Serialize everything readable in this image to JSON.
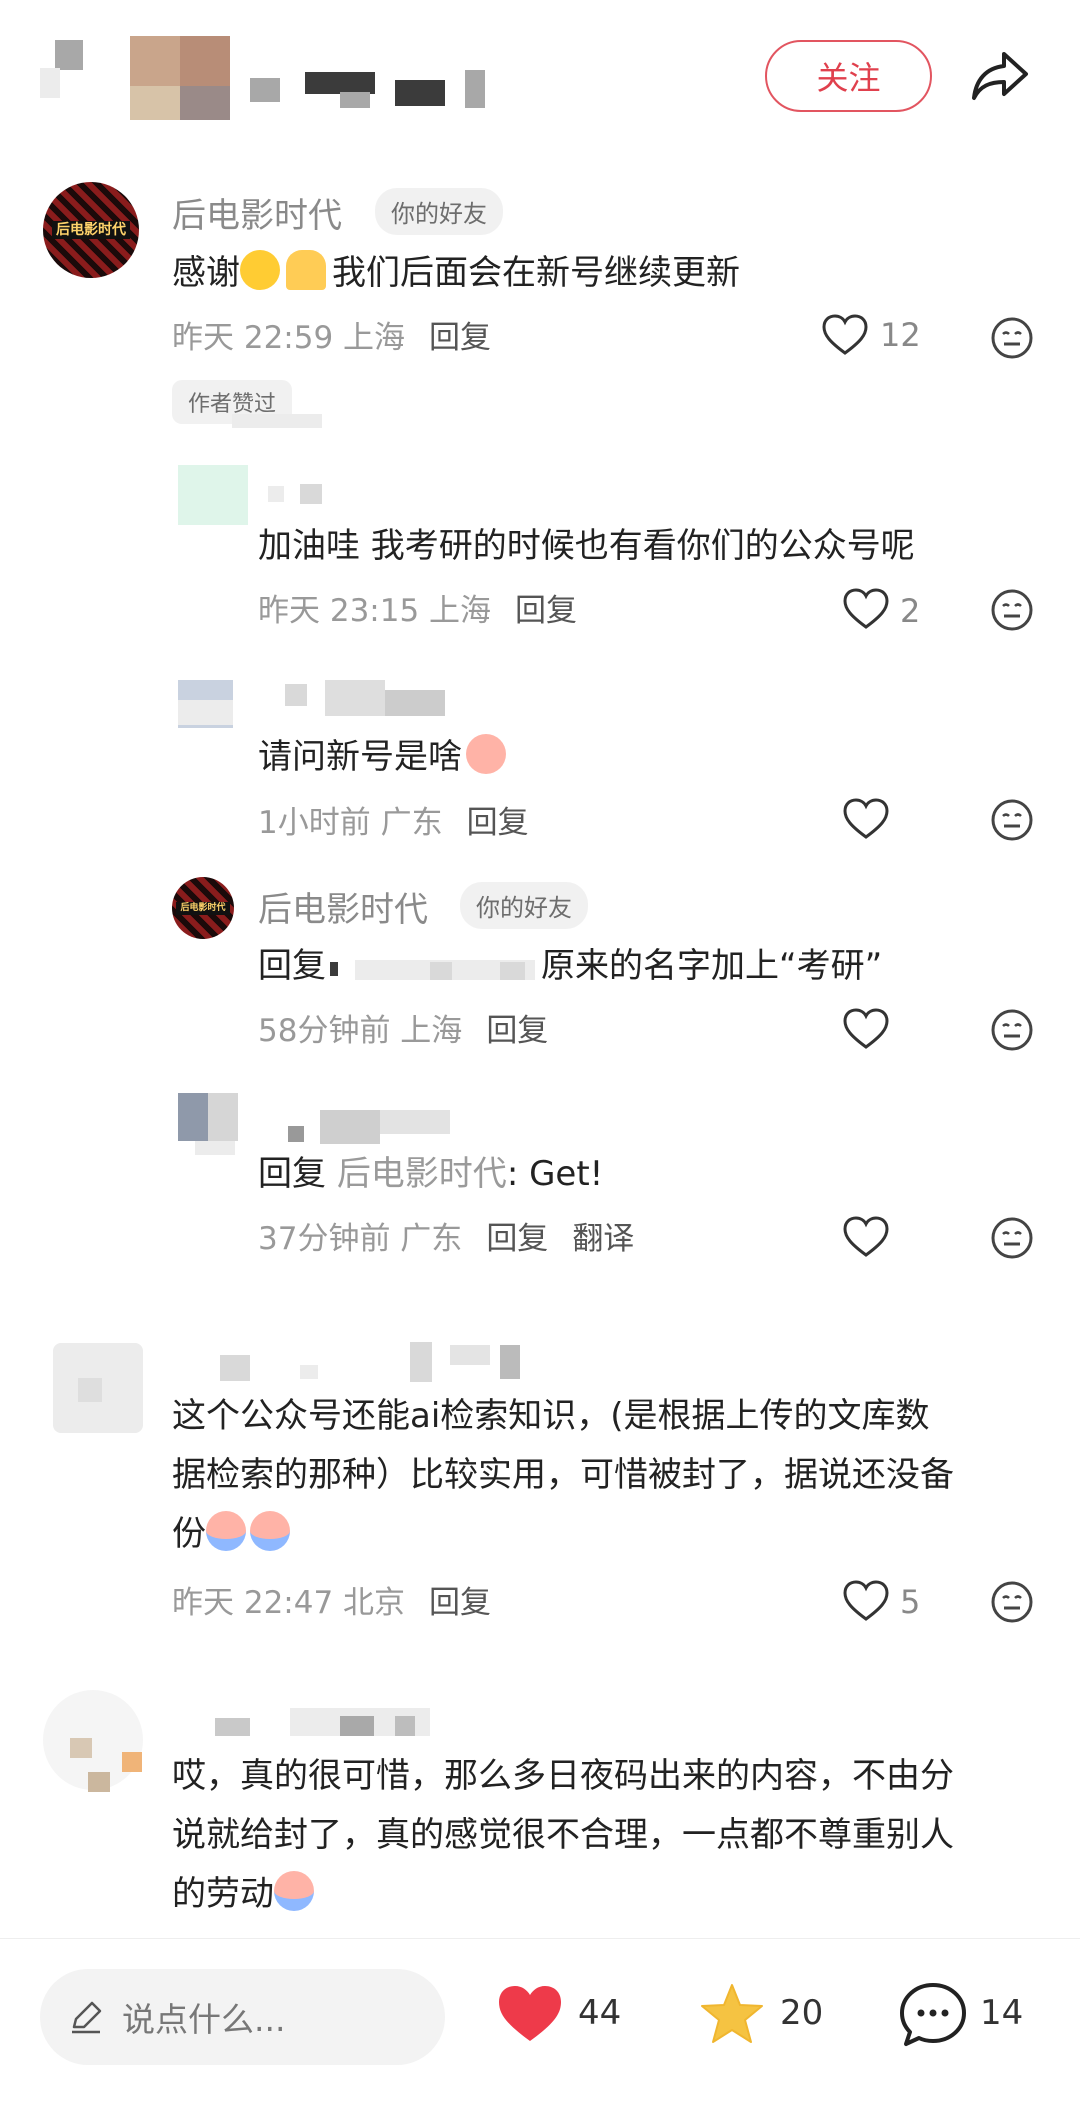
{
  "header": {
    "follow_label": "关注"
  },
  "comments": [
    {
      "author": "后电影时代",
      "tag": "你的好友",
      "text_a": "感谢",
      "text_b": "我们后面会在新号继续更新",
      "time": "昨天 22:59 上海",
      "reply": "回复",
      "likes": "12",
      "author_badge": "作者赞过"
    },
    {
      "text": "加油哇 我考研的时候也有看你们的公众号呢",
      "time": "昨天 23:15 上海",
      "reply": "回复",
      "likes": "2"
    },
    {
      "text": "请问新号是啥",
      "time": "1小时前 广东",
      "reply": "回复"
    },
    {
      "author": "后电影时代",
      "tag": "你的好友",
      "reply_prefix": "回复",
      "text": "原来的名字加上“考研”",
      "time": "58分钟前 上海",
      "reply": "回复"
    },
    {
      "reply_prefix": "回复",
      "reply_name": "后电影时代",
      "text": ": Get!",
      "time": "37分钟前 广东",
      "reply": "回复",
      "translate": "翻译"
    },
    {
      "line1": "这个公众号还能ai检索知识，(是根据上传的文库数",
      "line2": "据检索的那种）比较实用，可惜被封了，据说还没备",
      "line3": "份",
      "time": "昨天 22:47 北京",
      "reply": "回复",
      "likes": "5"
    },
    {
      "line1": "哎，真的很可惜，那么多日夜码出来的内容，不由分",
      "line2": "说就给封了，真的感觉很不合理，一点都不尊重别人",
      "line3": "的劳动"
    }
  ],
  "bottom": {
    "placeholder": "说点什么...",
    "likes": "44",
    "stars": "20",
    "comments": "14"
  },
  "colors": {
    "accent": "#e0404d",
    "star": "#f5c342",
    "heart": "#ee3a4a"
  }
}
